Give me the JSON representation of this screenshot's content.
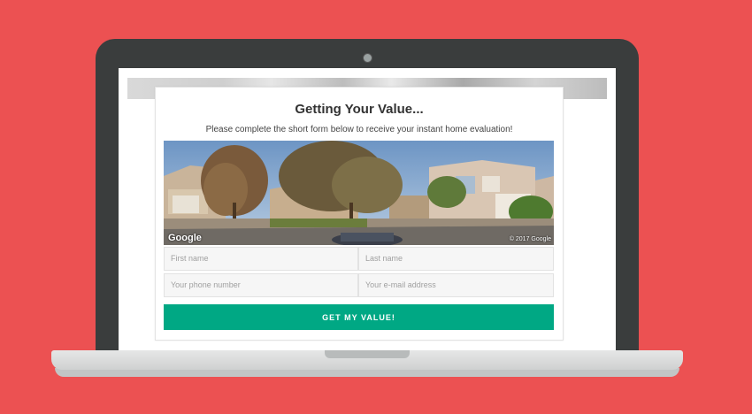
{
  "card": {
    "title": "Getting Your Value...",
    "subtitle": "Please complete the short form below to receive your instant home evaluation!"
  },
  "photo": {
    "provider_logo": "Google",
    "copyright": "© 2017 Google"
  },
  "form": {
    "first_name_placeholder": "First name",
    "last_name_placeholder": "Last name",
    "phone_placeholder": "Your phone number",
    "email_placeholder": "Your e-mail address",
    "submit_label": "GET MY VALUE!"
  },
  "colors": {
    "background": "#ec5152",
    "button": "#00a884",
    "laptop_bezel": "#3a3d3d"
  }
}
